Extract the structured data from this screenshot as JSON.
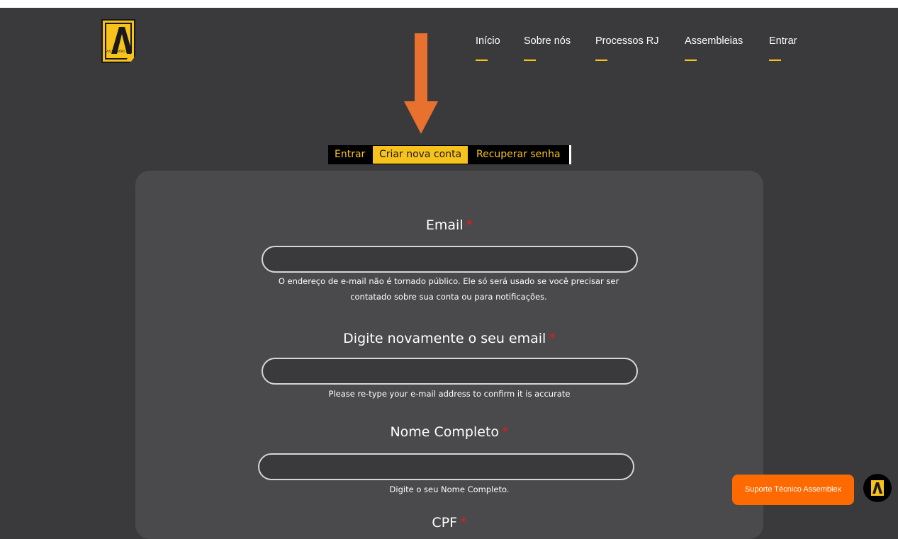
{
  "brand": {
    "logo_text": "ASSEMBLEX",
    "accent": "#f7c21b"
  },
  "nav": {
    "items": [
      "Início",
      "Sobre nós",
      "Processos RJ",
      "Assembleias",
      "Entrar"
    ]
  },
  "annotation": {
    "arrow_color": "#e8712f"
  },
  "tabs": {
    "login": "Entrar",
    "create": "Criar nova conta",
    "recover": "Recuperar senha",
    "active": "Criar nova conta"
  },
  "form": {
    "required_mark": "*",
    "email": {
      "label": "Email",
      "value": "",
      "help": "O endereço de e-mail não é tornado público. Ele só será usado se você precisar ser contatado sobre sua conta ou para notificações."
    },
    "confirm_email": {
      "label": "Digite novamente o seu email",
      "value": "",
      "help": "Please re-type your e-mail address to confirm it is accurate"
    },
    "full_name": {
      "label": "Nome Completo",
      "value": "",
      "help": "Digite o seu Nome Completo."
    },
    "cpf": {
      "label": "CPF"
    }
  },
  "support": {
    "label": "Suporte Técnico Assemblex",
    "color": "#ff6a00"
  }
}
